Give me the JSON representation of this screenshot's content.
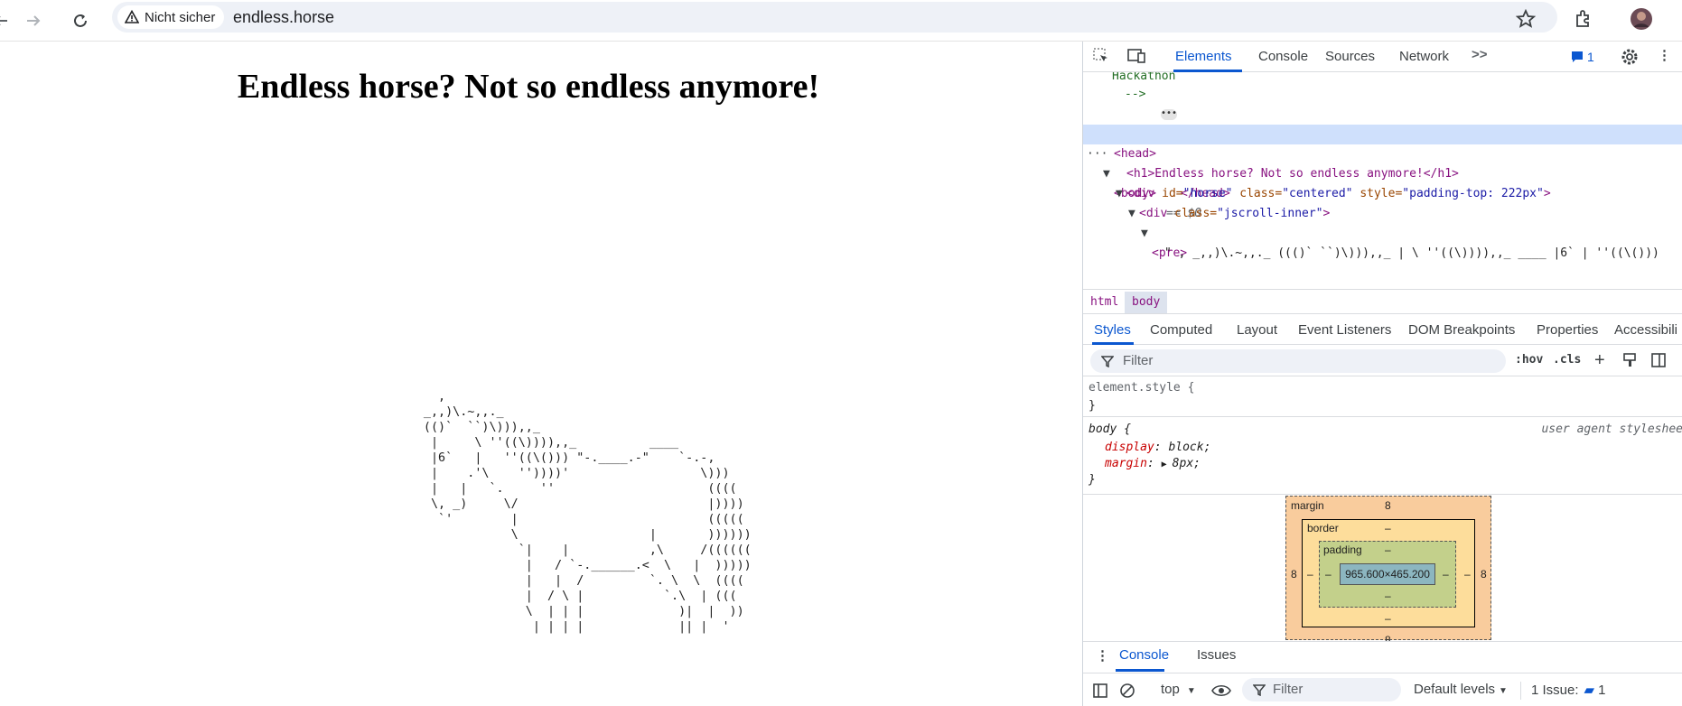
{
  "browser": {
    "security_label": "Nicht sicher",
    "url": "endless.horse"
  },
  "page": {
    "title": "Endless horse? Not so endless anymore!",
    "horse_art": "                 ,\n               _,,)\\.~,,._\n               (()`  ``)\\))),,_\n                |     \\ ''((\\)))),,_          ____\n                |6`   |   ''((\\())) \"-.____.-\"    `-.-,\n                |    .'\\    ''))))'                  \\)))\n                |   |   `.     ''                     ((((\n                \\, _)     \\/                          |))))\n                 `'        |                          (((((\n                           \\                  |       ))))))\n                            `|    |           ,\\     /((((((\n                             |   / `-.______.<  \\   |  )))))\n                             |   |  /         `. \\  \\  ((((\n                             |  / \\ |           `.\\  | (((\n                             \\  | | |             )|  |  ))\n                              | | | |             || |  '"
  },
  "devtools": {
    "tabs": [
      "Elements",
      "Console",
      "Sources",
      "Network"
    ],
    "issues_count": "1",
    "dom": {
      "comment_text": "Hackathon",
      "comment_end": "-->",
      "head_open": "<head>",
      "head_close": "</head>",
      "body_tag": "<body>",
      "body_ref": "== $0",
      "h1_line": "<h1>Endless horse? Not so endless anymore!</h1>",
      "div_tag_open": "<div ",
      "div_id_attr": "id=",
      "div_id_val": "\"horse\"",
      "div_class_attr": " class=",
      "div_class_val": "\"centered\"",
      "div_style_attr": " style=",
      "div_style_val": "\"padding-top: 222px\"",
      "div_close": ">",
      "inner_tag_open": "<div ",
      "inner_class_attr": "class=",
      "inner_class_val": "\"jscroll-inner\"",
      "inner_close": ">",
      "pre_tag": "<pre>",
      "pre_text": "\" , _,,)\\.~,,._ ((()` ``)\\))),,_ | \\ ''((\\)))),,_ ____ |6` | ''((\\()))"
    },
    "breadcrumbs": [
      "html",
      "body"
    ],
    "style_tabs": [
      "Styles",
      "Computed",
      "Layout",
      "Event Listeners",
      "DOM Breakpoints",
      "Properties",
      "Accessibili"
    ],
    "filter_placeholder": "Filter",
    "hov_label": ":hov",
    "cls_label": ".cls",
    "rules": {
      "element_style_selector": "element.style {",
      "close_brace": "}",
      "body_selector": "body {",
      "ua_label": "user agent styleshee",
      "display_prop": "display",
      "display_val": "block;",
      "margin_prop": "margin",
      "margin_val": "8px;"
    },
    "box_model": {
      "margin_label": "margin",
      "margin_top": "8",
      "margin_left": "8",
      "margin_right": "8",
      "margin_bottom": "8",
      "border_label": "border",
      "border_value": "–",
      "padding_label": "padding",
      "padding_value": "–",
      "content_size": "965.600×465.200"
    },
    "drawer": {
      "tabs": [
        "Console",
        "Issues"
      ],
      "context": "top",
      "filter_placeholder": "Filter",
      "levels": "Default levels",
      "issues_label": "1 Issue:",
      "issues_count": "1"
    }
  },
  "colors": {
    "accent": "#0b57d0",
    "tag": "#881280",
    "attr": "#994500",
    "attr_value": "#1a1aa6",
    "comment": "#236e25"
  }
}
